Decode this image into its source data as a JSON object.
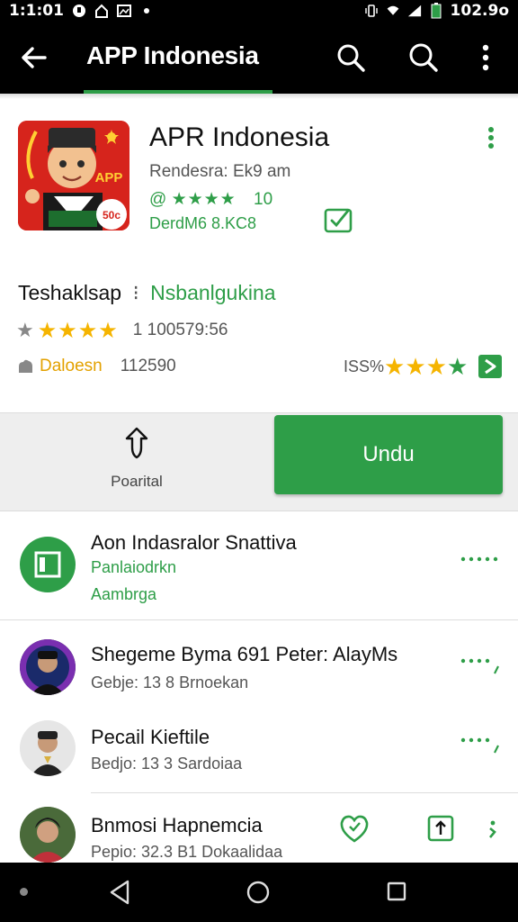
{
  "status_bar": {
    "time": "1:1:01",
    "battery": "102.9о"
  },
  "app_bar": {
    "title": "APP Indonesia"
  },
  "app": {
    "name": "APR Indonesia",
    "developer": "Rendesra: Ek9 am",
    "rating_prefix": "@",
    "rating_stars": "★★★★",
    "rating_value": "10",
    "version": "DerdM6 8.KC8",
    "icon_text": "APP",
    "icon_badge": "50c"
  },
  "info": {
    "tag_a": "Teshaklsap",
    "tag_sep": "⁝",
    "tag_b": "Nsbanlgukina",
    "rating_stars": "★★★★",
    "rating_count": "1 100579:56",
    "balance_label": "Daloesn",
    "balance_value": "112590",
    "pct": "ISS%",
    "pct_stars_gold": "★★★",
    "pct_star_green": "★"
  },
  "actions": {
    "share_label": "Poarital",
    "install_label": "Undu"
  },
  "list": [
    {
      "title": "Aon Indasralor Snattiva",
      "sub1": "Panlaiodrkn",
      "sub2": "Aambrga"
    },
    {
      "title": "Shegeme Byma 691 Peter: AlayMs",
      "sub1": "Gebje: 13 8 Brnoekan"
    },
    {
      "title": "Pecail Kieftile",
      "sub1": "Bedjo: 13 3 Sardoiaa"
    },
    {
      "title": "Bnmosi Hapnemcia",
      "sub1": "Pepio: 32.3 B1 Dokaalidaa"
    }
  ],
  "colors": {
    "accent": "#2e9e48",
    "star": "#f5b400",
    "brand_red": "#d6241c"
  },
  "icons": [
    "back-arrow-icon",
    "search-icon",
    "more-vert-icon",
    "check-badge-icon",
    "share-icon",
    "play-icon",
    "heart-clock-icon",
    "upload-icon"
  ]
}
